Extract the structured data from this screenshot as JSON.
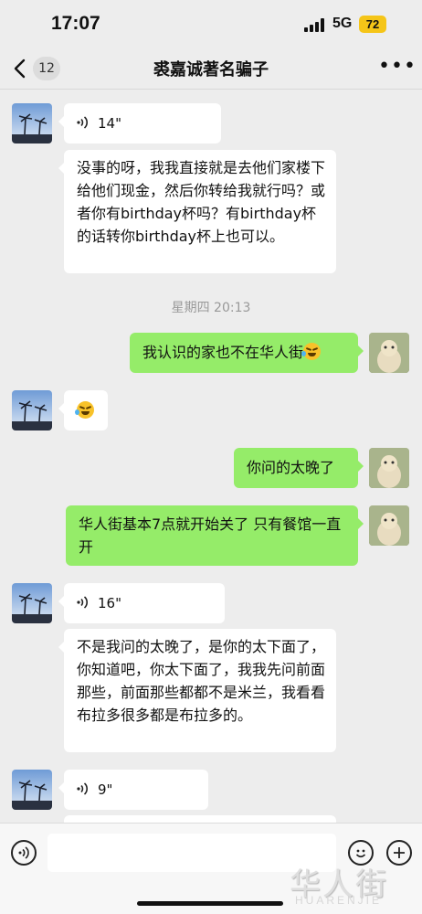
{
  "status_bar": {
    "time": "17:07",
    "network": "5G",
    "battery": "72"
  },
  "header": {
    "unread_count": "12",
    "title": "裘嘉诚著名骗子"
  },
  "messages": [
    {
      "side": "in",
      "type": "voice",
      "duration": "14\""
    },
    {
      "side": "in",
      "type": "text",
      "text": "没事的呀，我我直接就是去他们家楼下给他们现金，然后你转给我就行吗？或者你有birthday杯吗？有birthday杯的话转你birthday杯上也可以。"
    },
    {
      "side": "out",
      "type": "text",
      "text": "我认识的家也不在华人街",
      "emoji": "rolling-laughing-emoji"
    },
    {
      "side": "in",
      "type": "emoji",
      "emoji": "rolling-laughing-emoji"
    },
    {
      "side": "out",
      "type": "text",
      "text": "你问的太晚了"
    },
    {
      "side": "out",
      "type": "text",
      "text": "华人街基本7点就开始关了 只有餐馆一直开"
    },
    {
      "side": "in",
      "type": "voice",
      "duration": "16\""
    },
    {
      "side": "in",
      "type": "text",
      "text": "不是我问的太晚了，是你的太下面了，你知道吧，你太下面了，我我先问前面那些，前面那些都都不是米兰，我看看布拉多很多都是布拉多的。"
    },
    {
      "side": "in",
      "type": "voice",
      "duration": "9\""
    }
  ],
  "timestamp": "星期四 20:13",
  "watermark": {
    "cn": "华人街",
    "en": "HUARENJIE"
  },
  "colors": {
    "background": "#ededed",
    "bubble_out": "#95ec69",
    "bubble_in": "#ffffff",
    "battery": "#f5c518"
  }
}
